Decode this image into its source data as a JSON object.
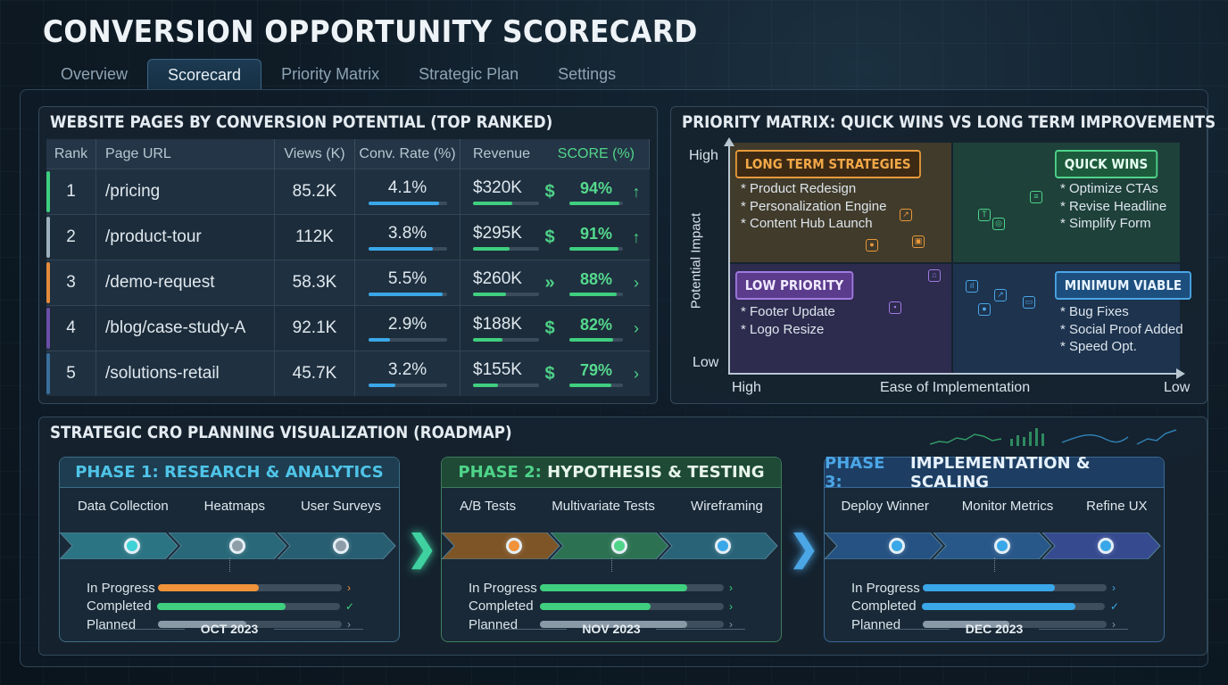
{
  "app": {
    "title": "CONVERSION OPPORTUNITY SCORECARD"
  },
  "tabs": [
    {
      "label": "Overview",
      "active": false
    },
    {
      "label": "Scorecard",
      "active": true
    },
    {
      "label": "Priority Matrix",
      "active": false
    },
    {
      "label": "Strategic Plan",
      "active": false
    },
    {
      "label": "Settings",
      "active": false
    }
  ],
  "pages_panel": {
    "title": "WEBSITE PAGES BY CONVERSION POTENTIAL (TOP RANKED)",
    "columns": [
      "Rank",
      "Page URL",
      "Views (K)",
      "Conv. Rate (%)",
      "Revenue",
      "SCORE (%)"
    ],
    "rows": [
      {
        "rank": "1",
        "url": "/pricing",
        "views": "85.2K",
        "conv": "4.1%",
        "conv_fill": 0.9,
        "revenue": "$320K",
        "rev_fill": 0.6,
        "score": "94%",
        "score_fill": 0.94,
        "symbol": "$",
        "trend": "↑",
        "accent": "#3fcf7f"
      },
      {
        "rank": "2",
        "url": "/product-tour",
        "views": "112K",
        "conv": "3.8%",
        "conv_fill": 0.82,
        "revenue": "$295K",
        "rev_fill": 0.55,
        "score": "91%",
        "score_fill": 0.91,
        "symbol": "$",
        "trend": "↑",
        "accent": "#9fb0bd"
      },
      {
        "rank": "3",
        "url": "/demo-request",
        "views": "58.3K",
        "conv": "5.5%",
        "conv_fill": 0.95,
        "revenue": "$260K",
        "rev_fill": 0.5,
        "score": "88%",
        "score_fill": 0.88,
        "symbol": "»",
        "trend": "›",
        "accent": "#e58a3a"
      },
      {
        "rank": "4",
        "url": "/blog/case-study-A",
        "views": "92.1K",
        "conv": "2.9%",
        "conv_fill": 0.28,
        "revenue": "$188K",
        "rev_fill": 0.45,
        "score": "82%",
        "score_fill": 0.82,
        "symbol": "$",
        "trend": "›",
        "accent": "#6a4fa8"
      },
      {
        "rank": "5",
        "url": "/solutions-retail",
        "views": "45.7K",
        "conv": "3.2%",
        "conv_fill": 0.35,
        "revenue": "$155K",
        "rev_fill": 0.38,
        "score": "79%",
        "score_fill": 0.79,
        "symbol": "$",
        "trend": "›",
        "accent": "#3a6f9a"
      }
    ]
  },
  "matrix_panel": {
    "title": "PRIORITY MATRIX: QUICK WINS VS LONG TERM IMPROVEMENTS",
    "y_axis": {
      "label": "Potential Impact",
      "high": "High",
      "low": "Low"
    },
    "x_axis": {
      "label": "Ease of Implementation",
      "high": "High",
      "low": "Low"
    },
    "quadrants": {
      "long_term": {
        "title": "LONG TERM STRATEGIES",
        "items": [
          "* Product Redesign",
          "* Personalization Engine",
          "* Content Hub Launch"
        ]
      },
      "quick_wins": {
        "title": "QUICK WINS",
        "items": [
          "* Optimize CTAs",
          "* Revise Headline",
          "* Simplify Form"
        ]
      },
      "low_priority": {
        "title": "LOW PRIORITY",
        "items": [
          "* Footer Update",
          "* Logo Resize"
        ]
      },
      "minimum_viable": {
        "title": "MINIMUM VIABLE",
        "items": [
          "* Bug Fixes",
          "* Social Proof Added",
          "* Speed Opt."
        ]
      }
    }
  },
  "roadmap_panel": {
    "title": "STRATEGIC CRO PLANNING VISUALIZATION (ROADMAP)",
    "phases": [
      {
        "prefix": "PHASE 1:",
        "name": "RESEARCH & ANALYTICS",
        "steps": [
          "Data Collection",
          "Heatmaps",
          "User Surveys"
        ],
        "date": "OCT 2023",
        "progress": [
          {
            "label": "In Progress",
            "fill": 0.55,
            "color": "#f0933a",
            "end": "›"
          },
          {
            "label": "Completed",
            "fill": 0.7,
            "color": "#3fcf7f",
            "end": "✓"
          },
          {
            "label": "Planned",
            "fill": 0.48,
            "color": "#8a99a6",
            "end": "›"
          }
        ]
      },
      {
        "prefix": "PHASE 2:",
        "name": "HYPOTHESIS & TESTING",
        "steps": [
          "A/B Tests",
          "Multivariate Tests",
          "Wireframing"
        ],
        "date": "NOV 2023",
        "progress": [
          {
            "label": "In Progress",
            "fill": 0.8,
            "color": "#3fcf7f",
            "end": "›"
          },
          {
            "label": "Completed",
            "fill": 0.6,
            "color": "#3fcf7f",
            "end": "›"
          },
          {
            "label": "Planned",
            "fill": 0.8,
            "color": "#8a99a6",
            "end": "›"
          }
        ]
      },
      {
        "prefix": "PHASE 3:",
        "name": "IMPLEMENTATION & SCALING",
        "steps": [
          "Deploy Winner",
          "Monitor Metrics",
          "Refine UX"
        ],
        "date": "DEC 2023",
        "progress": [
          {
            "label": "In Progress",
            "fill": 0.72,
            "color": "#3aa7e8",
            "end": "›"
          },
          {
            "label": "Completed",
            "fill": 0.84,
            "color": "#3aa7e8",
            "end": "✓"
          },
          {
            "label": "Planned",
            "fill": 0.47,
            "color": "#8a99a6",
            "end": "›"
          }
        ]
      }
    ]
  }
}
